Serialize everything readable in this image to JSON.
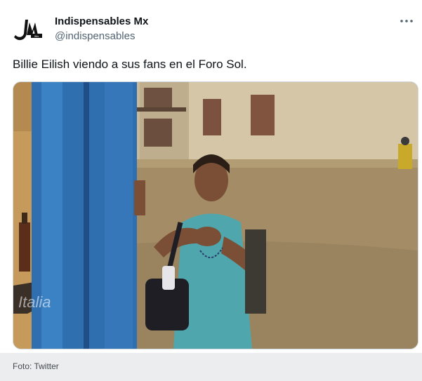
{
  "tweet": {
    "author_name": "Indispensables Mx",
    "author_handle": "@indispensables",
    "text": "Billie Eilish viendo a sus fans en el Foro Sol.",
    "more_icon": "more-horizontal-icon",
    "avatar_logo_text": "IMx",
    "media_watermark": "Italia"
  },
  "caption": {
    "text": "Foto: Twitter"
  },
  "colors": {
    "text_primary": "#0f1419",
    "text_secondary": "#536471",
    "caption_bg": "#ecedef"
  }
}
